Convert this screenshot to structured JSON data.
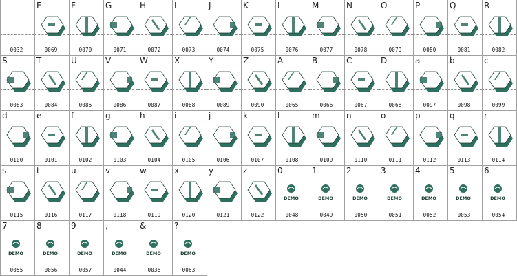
{
  "glyph_colors": {
    "face": "#ffffff",
    "shadow": "#2f6f5f",
    "outline": "#1d3d35"
  },
  "demo_badge": {
    "text": "DEMO",
    "icon": "demo-badge-icon"
  },
  "rows": [
    [
      {
        "char": "",
        "code": "0032",
        "glyph": "blank"
      },
      {
        "char": "E",
        "code": "0069",
        "glyph": "hex"
      },
      {
        "char": "F",
        "code": "0070",
        "glyph": "hex"
      },
      {
        "char": "G",
        "code": "0071",
        "glyph": "hex"
      },
      {
        "char": "H",
        "code": "0072",
        "glyph": "hex"
      },
      {
        "char": "I",
        "code": "0073",
        "glyph": "hex"
      },
      {
        "char": "J",
        "code": "0074",
        "glyph": "hex"
      },
      {
        "char": "K",
        "code": "0075",
        "glyph": "hex"
      },
      {
        "char": "L",
        "code": "0076",
        "glyph": "hex"
      },
      {
        "char": "M",
        "code": "0077",
        "glyph": "hex"
      },
      {
        "char": "N",
        "code": "0078",
        "glyph": "hex"
      },
      {
        "char": "O",
        "code": "0079",
        "glyph": "hex"
      },
      {
        "char": "P",
        "code": "0080",
        "glyph": "hex"
      },
      {
        "char": "Q",
        "code": "0081",
        "glyph": "hex"
      },
      {
        "char": "R",
        "code": "0082",
        "glyph": "hex"
      }
    ],
    [
      {
        "char": "S",
        "code": "0083",
        "glyph": "hex"
      },
      {
        "char": "T",
        "code": "0084",
        "glyph": "hex"
      },
      {
        "char": "U",
        "code": "0085",
        "glyph": "hex"
      },
      {
        "char": "V",
        "code": "0086",
        "glyph": "hex"
      },
      {
        "char": "W",
        "code": "0087",
        "glyph": "hex"
      },
      {
        "char": "X",
        "code": "0088",
        "glyph": "hex"
      },
      {
        "char": "Y",
        "code": "0089",
        "glyph": "hex"
      },
      {
        "char": "Z",
        "code": "0090",
        "glyph": "hex"
      },
      {
        "char": "A",
        "code": "0065",
        "glyph": "hex"
      },
      {
        "char": "B",
        "code": "0066",
        "glyph": "hex"
      },
      {
        "char": "C",
        "code": "0067",
        "glyph": "hex"
      },
      {
        "char": "D",
        "code": "0068",
        "glyph": "hex"
      },
      {
        "char": "a",
        "code": "0097",
        "glyph": "hex"
      },
      {
        "char": "b",
        "code": "0098",
        "glyph": "hex"
      },
      {
        "char": "c",
        "code": "0099",
        "glyph": "hex"
      }
    ],
    [
      {
        "char": "d",
        "code": "0100",
        "glyph": "hex"
      },
      {
        "char": "e",
        "code": "0101",
        "glyph": "hex"
      },
      {
        "char": "f",
        "code": "0102",
        "glyph": "hex"
      },
      {
        "char": "g",
        "code": "0103",
        "glyph": "hex"
      },
      {
        "char": "h",
        "code": "0104",
        "glyph": "hex"
      },
      {
        "char": "i",
        "code": "0105",
        "glyph": "hex"
      },
      {
        "char": "j",
        "code": "0106",
        "glyph": "hex"
      },
      {
        "char": "k",
        "code": "0107",
        "glyph": "hex"
      },
      {
        "char": "l",
        "code": "0108",
        "glyph": "hex"
      },
      {
        "char": "m",
        "code": "0109",
        "glyph": "hex"
      },
      {
        "char": "n",
        "code": "0110",
        "glyph": "hex"
      },
      {
        "char": "o",
        "code": "0111",
        "glyph": "hex"
      },
      {
        "char": "p",
        "code": "0112",
        "glyph": "hex"
      },
      {
        "char": "q",
        "code": "0113",
        "glyph": "hex"
      },
      {
        "char": "r",
        "code": "0114",
        "glyph": "hex"
      }
    ],
    [
      {
        "char": "s",
        "code": "0115",
        "glyph": "hex"
      },
      {
        "char": "t",
        "code": "0116",
        "glyph": "hex"
      },
      {
        "char": "u",
        "code": "0117",
        "glyph": "hex"
      },
      {
        "char": "v",
        "code": "0118",
        "glyph": "hex"
      },
      {
        "char": "w",
        "code": "0119",
        "glyph": "hex"
      },
      {
        "char": "x",
        "code": "0120",
        "glyph": "hex"
      },
      {
        "char": "y",
        "code": "0121",
        "glyph": "hex"
      },
      {
        "char": "z",
        "code": "0122",
        "glyph": "hex"
      },
      {
        "char": "0",
        "code": "0048",
        "glyph": "demo"
      },
      {
        "char": "1",
        "code": "0049",
        "glyph": "demo"
      },
      {
        "char": "2",
        "code": "0050",
        "glyph": "demo"
      },
      {
        "char": "3",
        "code": "0051",
        "glyph": "demo"
      },
      {
        "char": "4",
        "code": "0052",
        "glyph": "demo"
      },
      {
        "char": "5",
        "code": "0053",
        "glyph": "demo"
      },
      {
        "char": "6",
        "code": "0054",
        "glyph": "demo"
      }
    ],
    [
      {
        "char": "7",
        "code": "0055",
        "glyph": "demo"
      },
      {
        "char": "8",
        "code": "0056",
        "glyph": "demo"
      },
      {
        "char": "9",
        "code": "0057",
        "glyph": "demo"
      },
      {
        "char": ",",
        "code": "0044",
        "glyph": "demo"
      },
      {
        "char": "&",
        "code": "0038",
        "glyph": "demo"
      },
      {
        "char": "?",
        "code": "0063",
        "glyph": "demo"
      }
    ]
  ]
}
